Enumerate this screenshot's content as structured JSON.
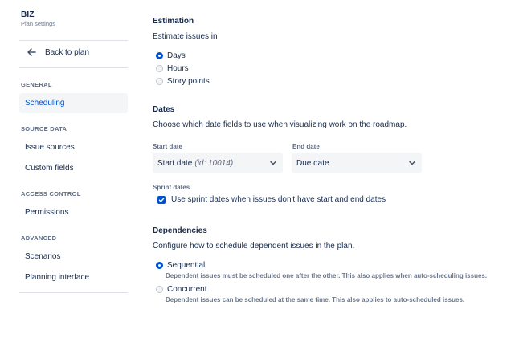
{
  "sidebar": {
    "project_name": "BIZ",
    "project_subtitle": "Plan settings",
    "back_label": "Back to plan",
    "sections": [
      {
        "heading": "GENERAL",
        "items": [
          {
            "label": "Scheduling"
          }
        ]
      },
      {
        "heading": "SOURCE DATA",
        "items": [
          {
            "label": "Issue sources"
          },
          {
            "label": "Custom fields"
          }
        ]
      },
      {
        "heading": "ACCESS CONTROL",
        "items": [
          {
            "label": "Permissions"
          }
        ]
      },
      {
        "heading": "ADVANCED",
        "items": [
          {
            "label": "Scenarios"
          },
          {
            "label": "Planning interface"
          }
        ]
      }
    ],
    "active_item": "Scheduling"
  },
  "estimation": {
    "heading": "Estimation",
    "description": "Estimate issues in",
    "options": [
      {
        "label": "Days",
        "checked": true
      },
      {
        "label": "Hours",
        "checked": false
      },
      {
        "label": "Story points",
        "checked": false
      }
    ]
  },
  "dates": {
    "heading": "Dates",
    "description": "Choose which date fields to use when visualizing work on the roadmap.",
    "start_date": {
      "label": "Start date",
      "value": "Start date",
      "value_note": "(id: 10014)"
    },
    "end_date": {
      "label": "End date",
      "value": "Due date"
    },
    "sprint_dates": {
      "label": "Sprint dates",
      "checkbox_label": "Use sprint dates when issues don't have start and end dates",
      "checked": true
    }
  },
  "dependencies": {
    "heading": "Dependencies",
    "description": "Configure how to schedule dependent issues in the plan.",
    "options": [
      {
        "label": "Sequential",
        "checked": true,
        "description": "Dependent issues must be scheduled one after the other. This also applies when auto-scheduling issues."
      },
      {
        "label": "Concurrent",
        "checked": false,
        "description": "Dependent issues can be scheduled at the same time. This also applies to auto-scheduled issues."
      }
    ]
  },
  "colors": {
    "accent": "#0052cc",
    "text": "#172b4d",
    "muted": "#6b778c",
    "field_bg": "#f4f5f7"
  }
}
